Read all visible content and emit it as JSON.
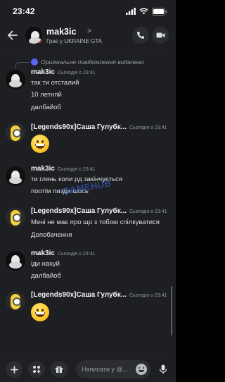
{
  "status_bar": {
    "time": "23:42"
  },
  "header": {
    "name": "mak3ic",
    "chevron": ">",
    "subtitle": "Грає у UKRAINE GTA"
  },
  "reply_preview": {
    "text": "Оригінальне повідомлення видалено"
  },
  "messages": [
    {
      "author": "mak3ic",
      "timestamp": "Сьогодні о 23:41",
      "lines": [
        "так ти отсталий",
        "10 летнпй",
        "далбайоб"
      ]
    },
    {
      "author": "[Legends90x]Саша Гулубк...",
      "timestamp": "Сьогодні о 23:41",
      "emoji": "grinning-face"
    },
    {
      "author": "mak3ic",
      "timestamp": "Сьогодні о 23:41",
      "lines": [
        "ти глянь коли рд закінчується",
        "поотім пизди шось"
      ]
    },
    {
      "author": "[Legends90x]Саша Гулубк...",
      "timestamp": "Сьогодні о 23:41",
      "lines": [
        "Мені не має про що з тобою спілкуватися",
        "Допобачення"
      ]
    },
    {
      "author": "mak3ic",
      "timestamp": "Сьогодні о 23:41",
      "lines": [
        "іди нахуй",
        "далбайоб"
      ]
    },
    {
      "author": "[Legends90x]Саша Гулубк...",
      "timestamp": "Сьогодні о 23:41",
      "emoji": "grinning-face"
    }
  ],
  "watermark": "GAMEHUB",
  "composer": {
    "placeholder": "Написати у @..."
  },
  "colors": {
    "background": "#1e1f22",
    "button": "#2b2d31",
    "accent": "#5865f2",
    "dnd": "#f23f43"
  }
}
